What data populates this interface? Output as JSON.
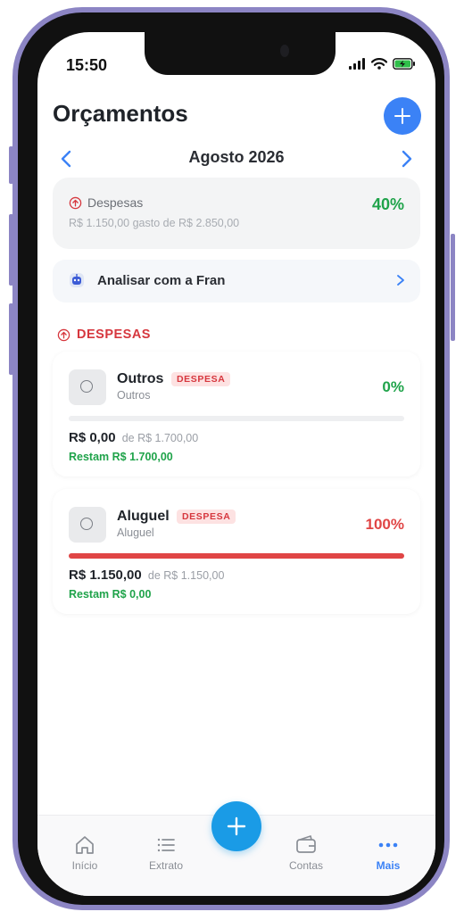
{
  "status_bar": {
    "time": "15:50"
  },
  "header": {
    "title": "Orçamentos",
    "add_icon": "plus-icon"
  },
  "month_nav": {
    "label": "Agosto 2026"
  },
  "summary": {
    "label": "Despesas",
    "detail": "R$ 1.150,00 gasto de R$ 2.850,00",
    "percent": "40%",
    "percent_color": "#1fa34a"
  },
  "assistant": {
    "label": "Analisar com a Fran",
    "icon": "robot-icon"
  },
  "section": {
    "title": "DESPESAS",
    "color": "#d6373e"
  },
  "budgets": [
    {
      "name": "Outros",
      "badge": "DESPESA",
      "category": "Outros",
      "percent": "0%",
      "percent_color": "#1fa34a",
      "progress": 0.0,
      "spent": "R$ 0,00",
      "limit": "de R$ 1.700,00",
      "remaining": "Restam R$ 1.700,00"
    },
    {
      "name": "Aluguel",
      "badge": "DESPESA",
      "category": "Aluguel",
      "percent": "100%",
      "percent_color": "#e04545",
      "progress": 1.0,
      "spent": "R$ 1.150,00",
      "limit": "de R$ 1.150,00",
      "remaining": "Restam R$ 0,00"
    }
  ],
  "tabbar": {
    "items": [
      {
        "label": "Início",
        "icon": "home-icon"
      },
      {
        "label": "Extrato",
        "icon": "list-icon"
      },
      {
        "label": "Contas",
        "icon": "wallet-icon"
      },
      {
        "label": "Mais",
        "icon": "more-icon"
      }
    ],
    "active": "Mais",
    "accent": "#3b82f6",
    "fab_icon": "plus-icon"
  }
}
